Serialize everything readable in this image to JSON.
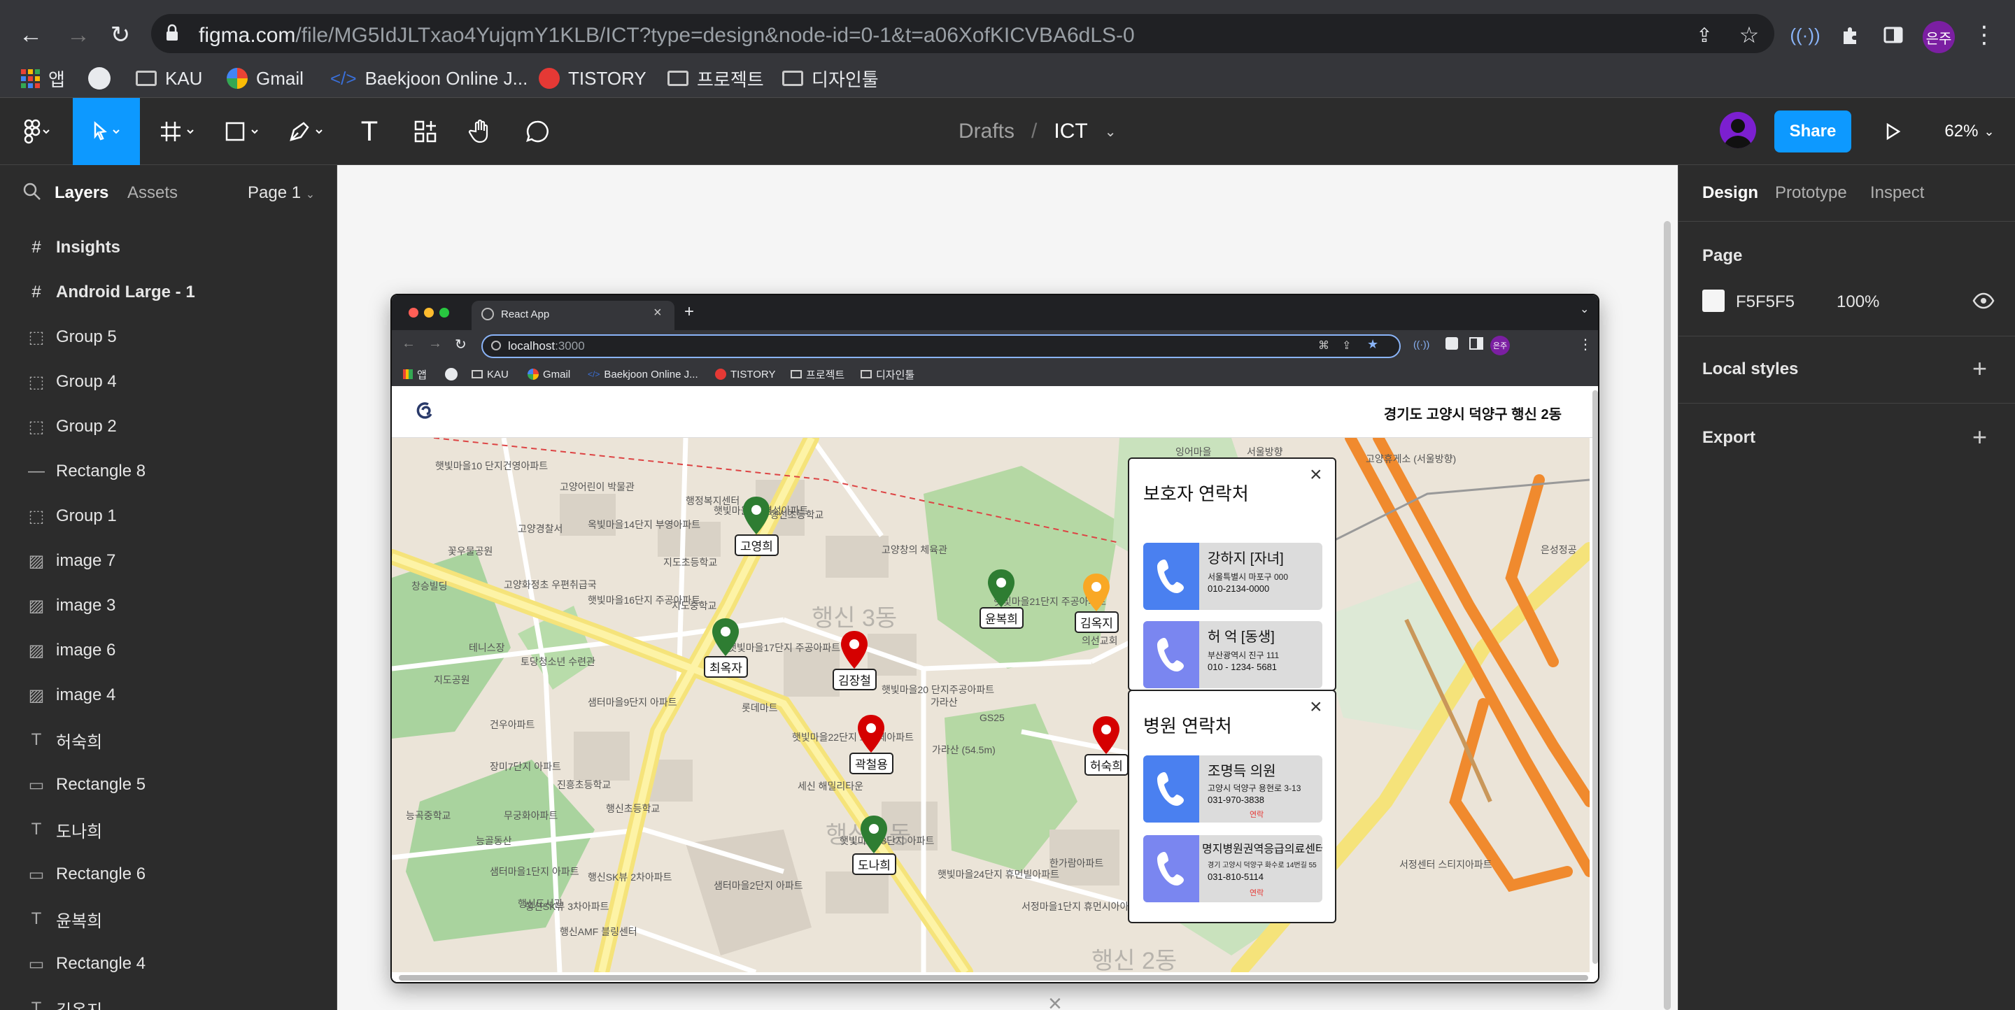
{
  "browser": {
    "url_host": "figma.com",
    "url_path": "/file/MG5IdJLTxao4YujqmY1KLB/ICT?type=design&node-id=0-1&t=a06XofKICVBA6dLS-0",
    "profile": "은주",
    "bookmarks": [
      "앱",
      "KAU",
      "Gmail",
      "Baekjoon Online J...",
      "TISTORY",
      "프로젝트",
      "디자인툴"
    ]
  },
  "figma": {
    "breadcrumb_parent": "Drafts",
    "breadcrumb_sep": "/",
    "file_name": "ICT",
    "share_label": "Share",
    "zoom": "62%",
    "left_tabs": {
      "layers": "Layers",
      "assets": "Assets",
      "page": "Page 1"
    },
    "layers": [
      {
        "name": "Insights",
        "icon": "frame-icon",
        "bold": true
      },
      {
        "name": "Android Large - 1",
        "icon": "frame-icon",
        "bold": true
      },
      {
        "name": "Group 5",
        "icon": "group-icon"
      },
      {
        "name": "Group 4",
        "icon": "group-icon"
      },
      {
        "name": "Group 2",
        "icon": "group-icon"
      },
      {
        "name": "Rectangle 8",
        "icon": "line-icon"
      },
      {
        "name": "Group 1",
        "icon": "group-icon"
      },
      {
        "name": "image 7",
        "icon": "image-icon"
      },
      {
        "name": "image 3",
        "icon": "image-icon"
      },
      {
        "name": "image 6",
        "icon": "image-icon"
      },
      {
        "name": "image 4",
        "icon": "image-icon"
      },
      {
        "name": "허숙희",
        "icon": "text-icon"
      },
      {
        "name": "Rectangle 5",
        "icon": "rectangle-icon"
      },
      {
        "name": "도나희",
        "icon": "text-icon"
      },
      {
        "name": "Rectangle 6",
        "icon": "rectangle-icon"
      },
      {
        "name": "윤복희",
        "icon": "text-icon"
      },
      {
        "name": "Rectangle 4",
        "icon": "rectangle-icon"
      },
      {
        "name": "김옥지",
        "icon": "text-icon"
      }
    ],
    "right_tabs": {
      "design": "Design",
      "prototype": "Prototype",
      "inspect": "Inspect"
    },
    "page_section": {
      "title": "Page",
      "color": "F5F5F5",
      "opacity": "100%"
    },
    "local_styles": "Local styles",
    "export": "Export"
  },
  "inner": {
    "tab_title": "React App",
    "url": "localhost:3000",
    "url_host": "localhost",
    "url_port": ":3000",
    "bookmarks": [
      "앱",
      "KAU",
      "Gmail",
      "Baekjoon Online J...",
      "TISTORY",
      "프로젝트",
      "디자인툴"
    ],
    "profile": "은주",
    "location": "경기도 고양시 덕양구 행신 2동",
    "persons": [
      {
        "name": "고영희",
        "color": "#2e7d32"
      },
      {
        "name": "최옥자",
        "color": "#2e7d32"
      },
      {
        "name": "김장철",
        "color": "#d50000"
      },
      {
        "name": "윤복희",
        "color": "#2e7d32"
      },
      {
        "name": "김옥지",
        "color": "#f9a825"
      },
      {
        "name": "곽철용",
        "color": "#d50000"
      },
      {
        "name": "허숙희",
        "color": "#d50000"
      },
      {
        "name": "도나희",
        "color": "#2e7d32"
      }
    ],
    "guardian": {
      "title": "보호자 연락처",
      "contacts": [
        {
          "name": "강하지 [자녀]",
          "addr": "서울특별시 마포구 000",
          "phone": "010-2134-0000"
        },
        {
          "name": "허 억 [동생]",
          "addr": "부산광역시 진구 111",
          "phone": "010 - 1234- 5681"
        }
      ]
    },
    "hospital": {
      "title": "병원 연락처",
      "contacts": [
        {
          "name": "조명득 의원",
          "addr": "고양시 덕양구 용현로 3-13",
          "phone": "031-970-3838",
          "badge": "연락"
        },
        {
          "name": "명지병원권역응급의료센터",
          "addr": "경기 고양시 덕양구 화수로 14번길 55",
          "phone": "031-810-5114",
          "badge": "연락"
        }
      ]
    },
    "map_labels": [
      "행신 3동",
      "행신 1동",
      "행신 2동",
      "햇빛마을10 단지건영아파트",
      "고양어린이 박물관",
      "행신초등학교",
      "고양경찰서",
      "꽃우물공원",
      "창승빌딩",
      "지도초등학교",
      "고양화정초 우편취급국",
      "지도중학교",
      "햇빛마을16단지 주공아파트",
      "토당청소년 수련관",
      "테니스장",
      "햇빛마을17단지 주공아파트",
      "지도공원",
      "샘터마을9단지 아파트",
      "건우아파트",
      "롯데마트",
      "햇빛마을22단지 프란체아파트",
      "가라산",
      "GS25",
      "햇빛마을20 단지주공아파트",
      "세신 해밀리타운",
      "장미7단지 아파트",
      "진흥초등학교",
      "무궁화아파트",
      "행신초등학교",
      "능곡중학교",
      "능골동산",
      "행신도서관",
      "서정마을1단지 휴먼시아아파트",
      "샘터마을2단지 아파트",
      "햇빛마을24단지 휴먼빌아파트",
      "행신AMF 블링센터",
      "햇빛마을23단지 아파트",
      "한가람아파트",
      "샘터마을1단지 아파트",
      "햇빛마을21단지 주공아파트",
      "의선교회",
      "고양창의 체육관",
      "서울방향",
      "고양휴게소 (서울방향)",
      "행신SK뷰 2차아파트",
      "행신SK뷰 3차아파트",
      "서정센터 스티지아파트",
      "은성정공",
      "가라산 (54.5m)",
      "햇빛마을15 경성아파트",
      "옥빛마을14단지 부영아파트",
      "행정복지센터",
      "잉어마을"
    ]
  }
}
